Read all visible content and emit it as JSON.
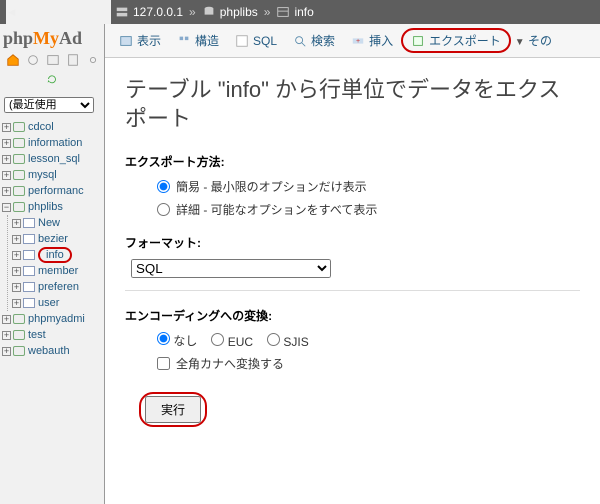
{
  "breadcrumb": {
    "server": "127.0.0.1",
    "db": "phplibs",
    "table": "info"
  },
  "logo": {
    "p1": "php",
    "p2": "My",
    "p3": "Ad"
  },
  "recent": {
    "label": "(最近使用"
  },
  "tree": {
    "items": [
      {
        "name": "cdcol"
      },
      {
        "name": "information"
      },
      {
        "name": "lesson_sql"
      },
      {
        "name": "mysql"
      },
      {
        "name": "performanc"
      },
      {
        "name": "phplibs",
        "expanded": true,
        "children": [
          {
            "name": "New"
          },
          {
            "name": "bezier"
          },
          {
            "name": "info",
            "selected": true
          },
          {
            "name": "member"
          },
          {
            "name": "preferen"
          },
          {
            "name": "user"
          }
        ]
      },
      {
        "name": "phpmyadmi"
      },
      {
        "name": "test"
      },
      {
        "name": "webauth"
      }
    ]
  },
  "tabs": {
    "items": [
      "表示",
      "構造",
      "SQL",
      "検索",
      "挿入",
      "エクスポート"
    ],
    "more": "その"
  },
  "heading": "テーブル \"info\" から行単位でデータをエクスポート",
  "export": {
    "label": "エクスポート方法:",
    "opt1": "簡易 - 最小限のオプションだけ表示",
    "opt2": "詳細 - 可能なオプションをすべて表示"
  },
  "format": {
    "label": "フォーマット:",
    "value": "SQL"
  },
  "encoding": {
    "label": "エンコーディングへの変換:",
    "none": "なし",
    "euc": "EUC",
    "sjis": "SJIS",
    "zenkaku": "全角カナへ変換する"
  },
  "execute": {
    "label": "実行"
  }
}
